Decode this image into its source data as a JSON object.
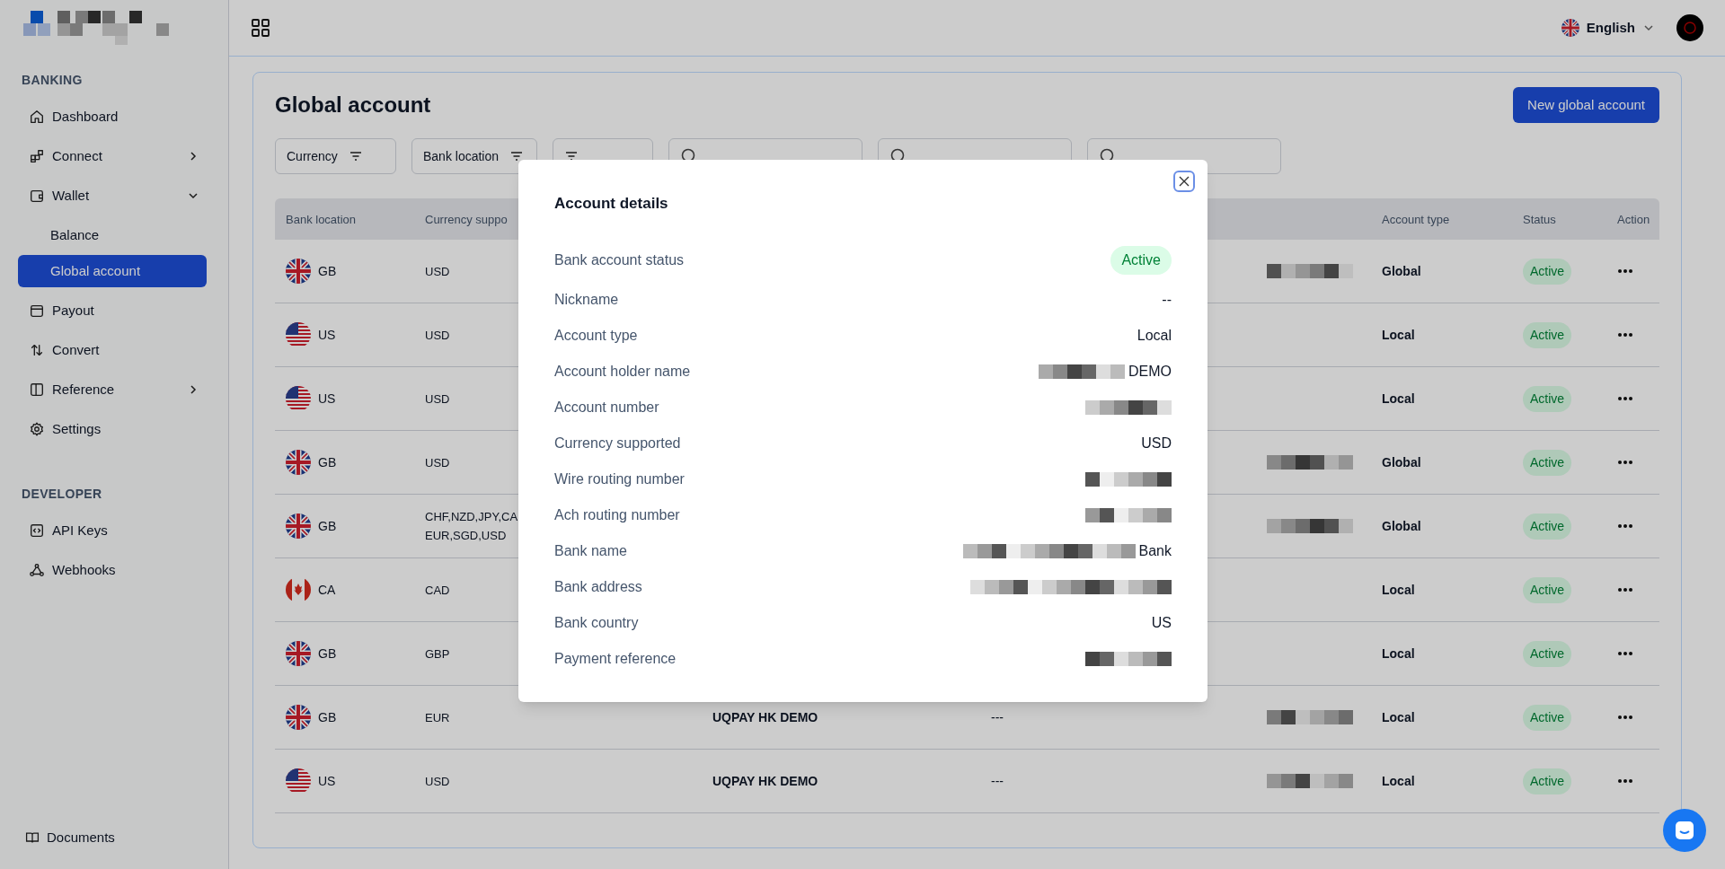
{
  "header": {
    "language": "English"
  },
  "sidebar": {
    "sections": [
      {
        "title": "BANKING",
        "items": [
          {
            "label": "Dashboard",
            "selected": false
          },
          {
            "label": "Connect",
            "selected": false,
            "expanded": false
          },
          {
            "label": "Wallet",
            "selected": false,
            "expanded": true,
            "children": [
              {
                "label": "Balance",
                "selected": false
              },
              {
                "label": "Global account",
                "selected": true
              }
            ]
          },
          {
            "label": "Payout",
            "selected": false
          },
          {
            "label": "Convert",
            "selected": false
          },
          {
            "label": "Reference",
            "selected": false,
            "expanded": false
          },
          {
            "label": "Settings",
            "selected": false
          }
        ]
      },
      {
        "title": "DEVELOPER",
        "items": [
          {
            "label": "API Keys",
            "selected": false
          },
          {
            "label": "Webhooks",
            "selected": false
          }
        ]
      }
    ],
    "footer": {
      "label": "Documents"
    }
  },
  "page": {
    "title": "Global account",
    "primary_button": "New global account",
    "filters": [
      {
        "kind": "filter",
        "label": "Currency"
      },
      {
        "kind": "filter",
        "label": "Bank location"
      },
      {
        "kind": "filter"
      },
      {
        "kind": "search"
      },
      {
        "kind": "search"
      },
      {
        "kind": "search"
      }
    ],
    "table": {
      "columns": [
        {
          "label": "Bank location"
        },
        {
          "label": "Currency suppo"
        },
        {},
        {},
        {},
        {
          "label": "Account type"
        },
        {
          "label": "Status"
        },
        {
          "label": "Action"
        }
      ],
      "rows": [
        {
          "kind": "gb",
          "location": "GB",
          "currency": "USD",
          "redacted": true,
          "account_type": "Global",
          "status": "Active"
        },
        {
          "kind": "us",
          "location": "US",
          "currency": "USD",
          "account_type": "Local",
          "status": "Active"
        },
        {
          "kind": "us",
          "location": "US",
          "currency": "USD",
          "account_type": "Local",
          "status": "Active"
        },
        {
          "kind": "gb",
          "location": "GB",
          "currency": "USD",
          "redacted": true,
          "account_type": "Global",
          "status": "Active"
        },
        {
          "kind": "gb",
          "location": "GB",
          "currency": "CHF,NZD,JPY,CA\nEUR,SGD,USD",
          "redacted": true,
          "account_type": "Global",
          "status": "Active"
        },
        {
          "kind": "ca",
          "location": "CA",
          "currency": "CAD",
          "account_type": "Local",
          "status": "Active"
        },
        {
          "kind": "gb",
          "location": "GB",
          "currency": "GBP",
          "account_type": "Local",
          "status": "Active"
        },
        {
          "kind": "gb",
          "location": "GB",
          "currency": "EUR",
          "bank_name": "UQPAY HK DEMO",
          "column_4": "---",
          "redacted": true,
          "account_type": "Local",
          "status": "Active"
        },
        {
          "kind": "us",
          "location": "US",
          "currency": "USD",
          "bank_name": "UQPAY HK DEMO",
          "column_4": "---",
          "redacted": true,
          "account_type": "Local",
          "status": "Active"
        }
      ]
    }
  },
  "modal": {
    "title": "Account details",
    "rows": [
      {
        "kind": "badge",
        "label": "Bank account status",
        "value": "Active"
      },
      {
        "kind": "text",
        "label": "Nickname",
        "value": "--"
      },
      {
        "kind": "text",
        "label": "Account type",
        "value": "Local"
      },
      {
        "kind": "text",
        "label": "Account holder name",
        "value": "DEMO",
        "redacted": true
      },
      {
        "kind": "text",
        "label": "Account number",
        "redacted": true
      },
      {
        "kind": "text",
        "label": "Currency supported",
        "value": "USD"
      },
      {
        "kind": "text",
        "label": "Wire routing number",
        "redacted": true
      },
      {
        "kind": "text",
        "label": "Ach routing number",
        "redacted": true
      },
      {
        "kind": "text",
        "label": "Bank name",
        "value": "Bank",
        "redacted": true
      },
      {
        "kind": "text",
        "label": "Bank address",
        "redacted": true
      },
      {
        "kind": "text",
        "label": "Bank country",
        "value": "US"
      },
      {
        "kind": "text",
        "label": "Payment reference",
        "redacted": true
      }
    ]
  }
}
